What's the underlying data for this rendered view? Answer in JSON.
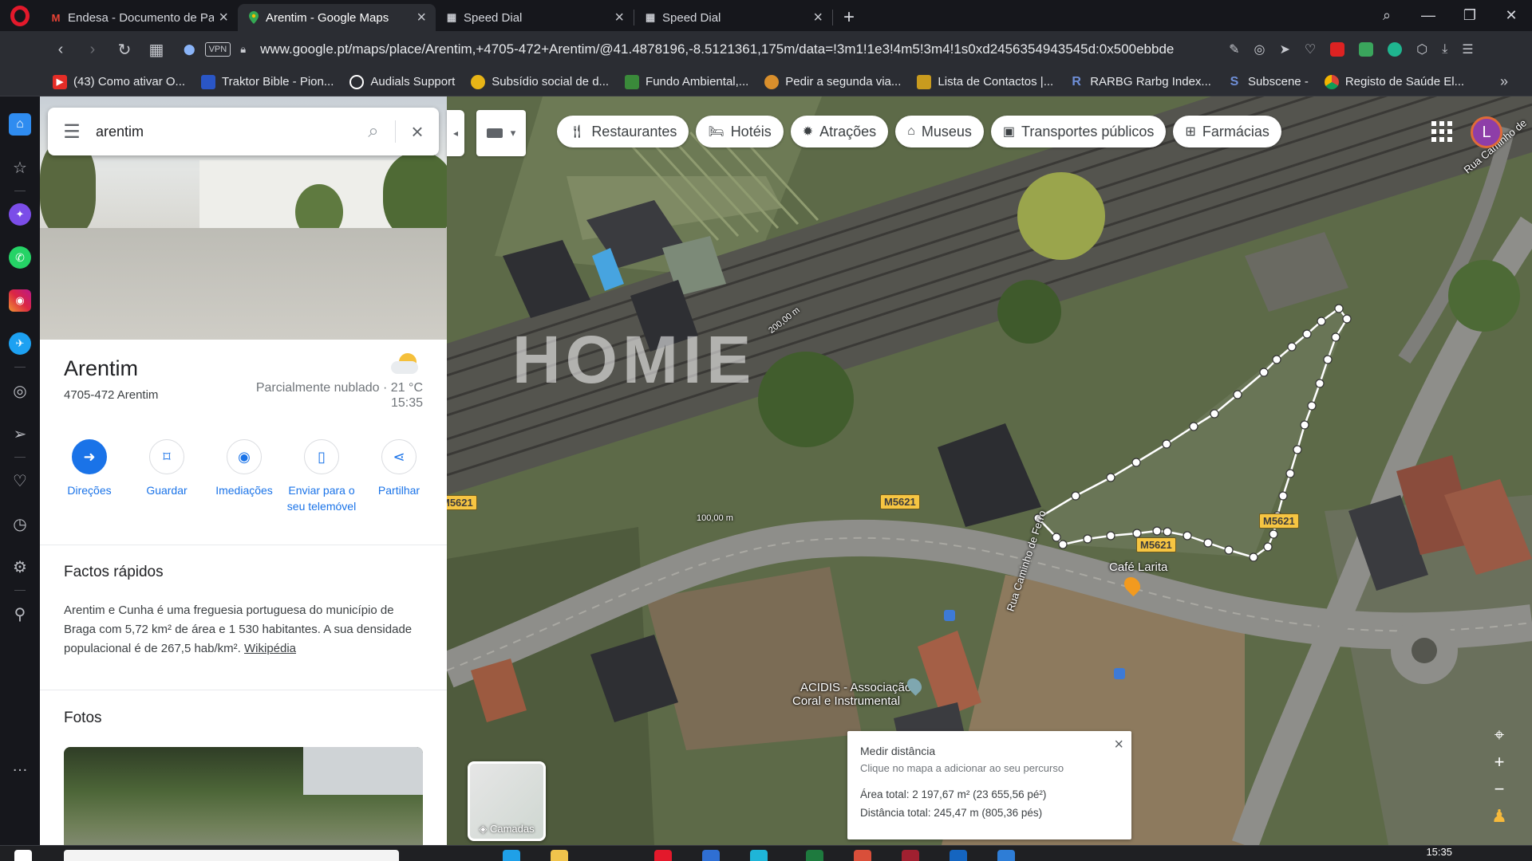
{
  "tabs": [
    {
      "icon": "gmail-icon",
      "title": "Endesa - Documento de Pa",
      "active": false
    },
    {
      "icon": "maps-pin-icon",
      "title": "Arentim - Google Maps",
      "active": true
    },
    {
      "icon": "speed-dial-icon",
      "title": "Speed Dial",
      "active": false
    },
    {
      "icon": "speed-dial-icon",
      "title": "Speed Dial",
      "active": false
    }
  ],
  "address": {
    "vpn_label": "VPN",
    "url": "www.google.pt/maps/place/Arentim,+4705-472+Arentim/@41.4878196,-8.5121361,175m/data=!3m1!1e3!4m5!3m4!1s0xd2456354943545d:0x500ebbde"
  },
  "bookmarks": [
    {
      "label": "(43) Como ativar O...",
      "icon": "youtube-icon",
      "color": "#e52d27"
    },
    {
      "label": "Traktor Bible - Pion...",
      "icon": "bookmark-icon",
      "color": "#2a56c6"
    },
    {
      "label": "Audials Support",
      "icon": "audials-icon",
      "color": "#ffffff"
    },
    {
      "label": "Subsídio social de d...",
      "icon": "bookmark-icon",
      "color": "#e7b416"
    },
    {
      "label": "Fundo Ambiental,...",
      "icon": "bookmark-icon",
      "color": "#3a8a3a"
    },
    {
      "label": "Pedir a segunda via...",
      "icon": "bookmark-icon",
      "color": "#d98f2c"
    },
    {
      "label": "Lista de Contactos |...",
      "icon": "bookmark-icon",
      "color": "#c99b1e"
    },
    {
      "label": "RARBG Rarbg Index...",
      "icon": "rarbg-icon",
      "color": "#6f8fd8"
    },
    {
      "label": "Subscene -",
      "icon": "subscene-icon",
      "color": "#2a56c6"
    },
    {
      "label": "Registo de Saúde El...",
      "icon": "chrome-icon",
      "color": "#db4437"
    }
  ],
  "search": {
    "query": "arentim"
  },
  "place": {
    "name": "Arentim",
    "address": "4705-472 Arentim",
    "weather": "Parcialmente nublado · 21 °C",
    "time": "15:35"
  },
  "actions": [
    {
      "label": "Direções",
      "icon": "directions-icon",
      "primary": true
    },
    {
      "label": "Guardar",
      "icon": "bookmark-icon",
      "primary": false
    },
    {
      "label": "Imediações",
      "icon": "nearby-icon",
      "primary": false
    },
    {
      "label": "Enviar para o seu telemóvel",
      "icon": "send-to-phone-icon",
      "primary": false
    },
    {
      "label": "Partilhar",
      "icon": "share-icon",
      "primary": false
    }
  ],
  "facts": {
    "heading": "Factos rápidos",
    "text": "Arentim e Cunha é uma freguesia portuguesa do município de Braga com 5,72 km² de área e 1 530 habitantes. A sua densidade populacional é de 267,5 hab/km².",
    "link": "Wikipédia"
  },
  "photos": {
    "heading": "Fotos"
  },
  "chips": [
    {
      "label": "Restaurantes",
      "icon": "restaurant-icon"
    },
    {
      "label": "Hotéis",
      "icon": "hotel-icon"
    },
    {
      "label": "Atrações",
      "icon": "attractions-icon"
    },
    {
      "label": "Museus",
      "icon": "museum-icon"
    },
    {
      "label": "Transportes públicos",
      "icon": "transit-icon"
    },
    {
      "label": "Farmácias",
      "icon": "pharmacy-icon"
    }
  ],
  "avatar": {
    "initial": "L"
  },
  "map": {
    "watermark": "HOMIE",
    "labels": {
      "rua_top": "Rua Caminho de",
      "rua_ferro": "Rua Caminho de Ferro",
      "cafe": "Café Larita",
      "acidis": "ACIDIS - Associação",
      "acidis2": "Coral e Instrumental",
      "dist_200": "200,00 m",
      "dist_100": "100,00 m"
    },
    "road_signs": [
      "M5621",
      "M5621",
      "M5621",
      "M5621"
    ],
    "layers_label": "Camadas"
  },
  "measure": {
    "title": "Medir distância",
    "hint": "Clique no mapa a adicionar ao seu percurso",
    "area": "Área total: 2 197,67 m² (23 655,56 pé²)",
    "distance": "Distância total: 245,47 m (805,36 pés)"
  },
  "taskbar": {
    "clock": "15:35"
  }
}
